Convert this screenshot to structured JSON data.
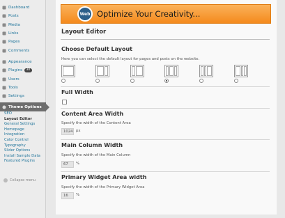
{
  "sidebar": {
    "items": [
      {
        "label": "Dashboard",
        "icon": "dashboard-icon"
      },
      {
        "label": "Posts",
        "icon": "pin-icon"
      },
      {
        "label": "Media",
        "icon": "media-icon"
      },
      {
        "label": "Links",
        "icon": "link-icon"
      },
      {
        "label": "Pages",
        "icon": "page-icon"
      },
      {
        "label": "Comments",
        "icon": "comment-icon"
      },
      {
        "label": "Appearance",
        "icon": "appearance-icon"
      },
      {
        "label": "Plugins",
        "icon": "plugin-icon",
        "badge": "30"
      },
      {
        "label": "Users",
        "icon": "users-icon"
      },
      {
        "label": "Tools",
        "icon": "tools-icon"
      },
      {
        "label": "Settings",
        "icon": "settings-icon"
      }
    ],
    "theme_options": "Theme Options",
    "submenu": [
      "SEO",
      "Layout Editor",
      "General Settings",
      "Homepage",
      "Integration",
      "Color Control",
      "Typography",
      "Slider Options",
      "Install Sample Data",
      "Featured Plugins"
    ],
    "current_sub": "Layout Editor",
    "collapse": "Collapse menu"
  },
  "banner": {
    "logo_text": "Web",
    "text": "Optimize Your Creativity..."
  },
  "page": {
    "title": "Layout Editor",
    "default_layout": {
      "heading": "Choose Default Layout",
      "desc": "Here you can select the default layout for pages and posts on the website.",
      "selected_index": 3
    },
    "full_width": {
      "heading": "Full Width",
      "checked": false
    },
    "content_area": {
      "heading": "Content Area Width",
      "desc": "Specify the width of the Content Area",
      "value": "1024",
      "unit": "px"
    },
    "main_column": {
      "heading": "Main Column Width",
      "desc": "Specify the width of the Main Column",
      "value": "67",
      "unit": "%"
    },
    "primary_widget": {
      "heading": "Primary Widget Area width",
      "desc": "Specify the width of the Primary Widget Area",
      "value": "16",
      "unit": "%"
    }
  },
  "colors": {
    "accent": "#21759b",
    "banner": "#f6911e",
    "menu_active": "#6d6d6d"
  }
}
